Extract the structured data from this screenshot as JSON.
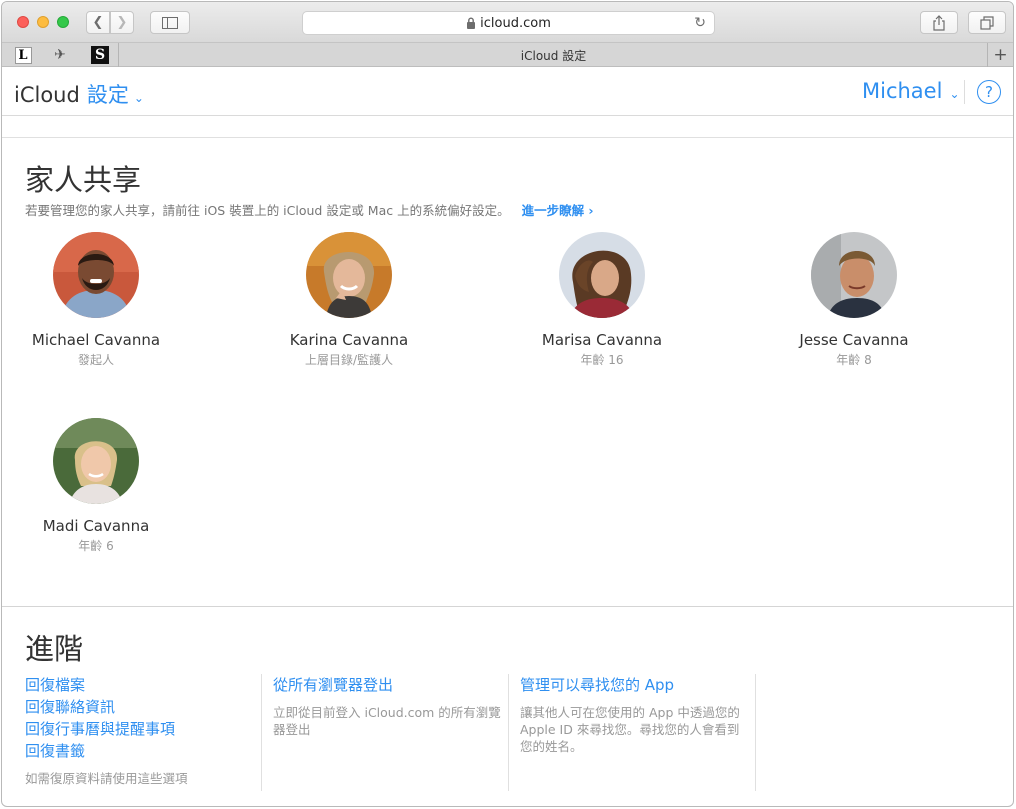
{
  "browser": {
    "url": "icloud.com",
    "tab_title": "iCloud 設定",
    "favorites": [
      {
        "label": "L"
      },
      {
        "label": "✈"
      },
      {
        "label": "S"
      }
    ]
  },
  "header": {
    "brand": "iCloud",
    "section": "設定",
    "user": "Michael",
    "help": "?"
  },
  "family": {
    "title": "家人共享",
    "description": "若要管理您的家人共享，請前往 iOS 裝置上的 iCloud 設定或 Mac 上的系統偏好設定。",
    "learn_more": "進一步瞭解 ›",
    "members": [
      {
        "name": "Michael Cavanna",
        "role": "發起人"
      },
      {
        "name": "Karina Cavanna",
        "role": "上層目錄/監護人"
      },
      {
        "name": "Marisa Cavanna",
        "role": "年齡 16"
      },
      {
        "name": "Jesse Cavanna",
        "role": "年齡 8"
      },
      {
        "name": "Madi Cavanna",
        "role": "年齡 6"
      }
    ]
  },
  "advanced": {
    "title": "進階",
    "col1": {
      "links": [
        "回復檔案",
        "回復聯絡資訊",
        "回復行事曆與提醒事項",
        "回復書籤"
      ],
      "note": "如需復原資料請使用這些選項"
    },
    "col2": {
      "link": "從所有瀏覽器登出",
      "note": "立即從目前登入 iCloud.com 的所有瀏覽器登出"
    },
    "col3": {
      "link": "管理可以尋找您的 App",
      "note": "讓其他人可在您使用的 App 中透過您的 Apple ID 來尋找您。尋找您的人會看到您的姓名。"
    }
  },
  "colors": {
    "accent": "#2f8ff0",
    "text": "#333333",
    "muted": "#999999"
  }
}
